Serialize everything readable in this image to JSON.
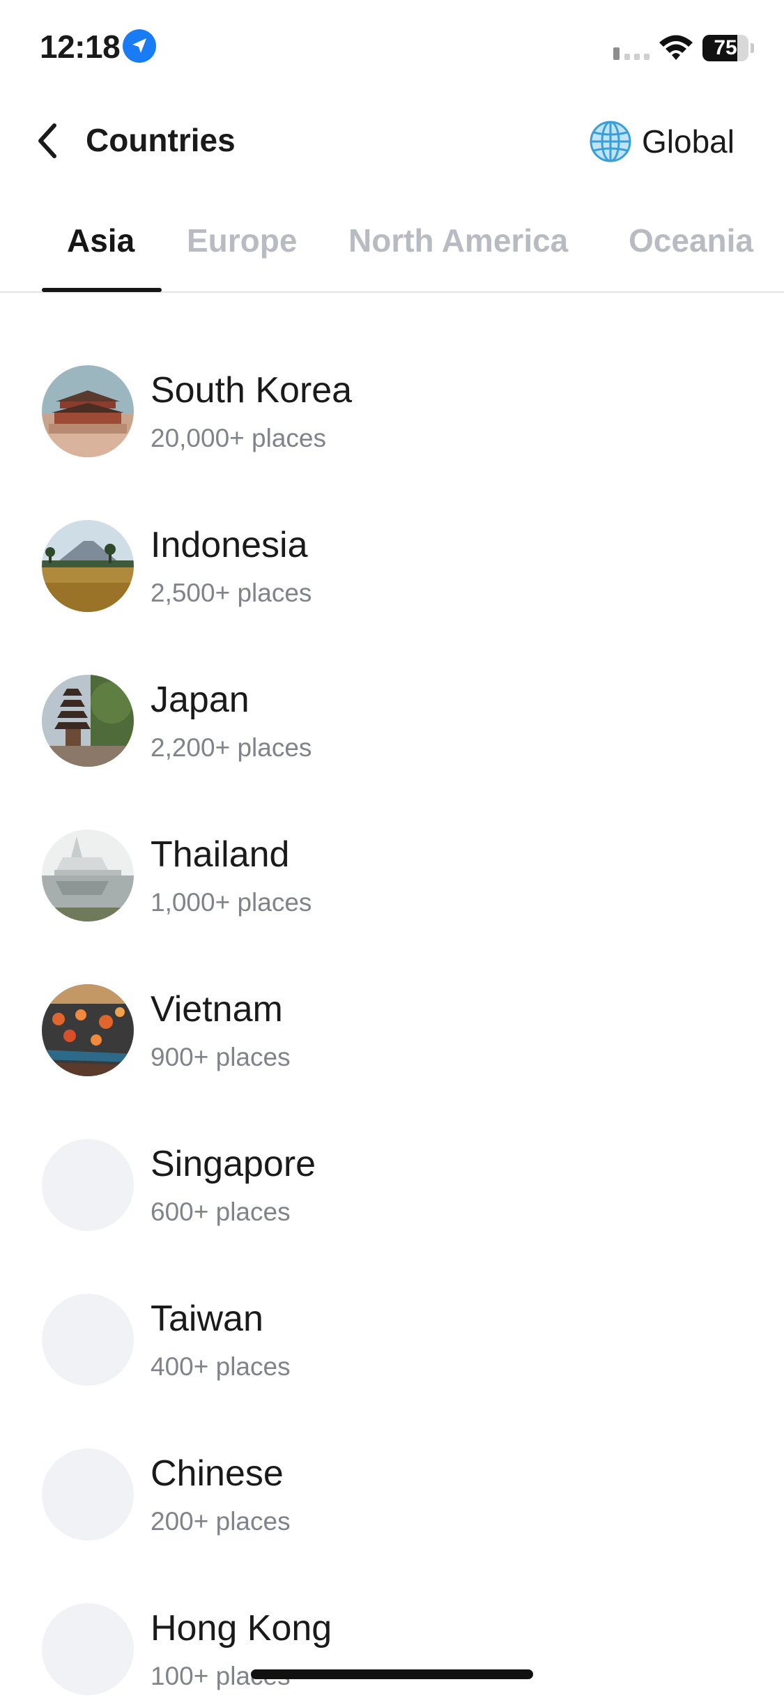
{
  "status_bar": {
    "time": "12:18",
    "battery_level": "75",
    "battery_fraction": 0.75,
    "location_color": "#1a7cf5",
    "icons": [
      "location-arrow-icon",
      "cellular-signal-icon",
      "wifi-icon",
      "battery-icon"
    ]
  },
  "header": {
    "back_icon": "chevron-left-icon",
    "title": "Countries",
    "global_icon": "globe-icon",
    "global_label": "Global",
    "globe_color": "#3a9fd8"
  },
  "tabs": [
    {
      "label": "Asia",
      "active": true
    },
    {
      "label": "Europe",
      "active": false
    },
    {
      "label": "North America",
      "active": false
    },
    {
      "label": "Oceania",
      "active": false
    }
  ],
  "countries": [
    {
      "name": "South Korea",
      "count": "20,000+ places",
      "thumbnail": "palace-photo"
    },
    {
      "name": "Indonesia",
      "count": "2,500+ places",
      "thumbnail": "volcano-field-photo"
    },
    {
      "name": "Japan",
      "count": "2,200+ places",
      "thumbnail": "pagoda-street-photo"
    },
    {
      "name": "Thailand",
      "count": "1,000+ places",
      "thumbnail": "white-temple-photo"
    },
    {
      "name": "Vietnam",
      "count": "900+ places",
      "thumbnail": "lantern-boats-photo"
    },
    {
      "name": "Singapore",
      "count": "600+ places",
      "thumbnail": "placeholder"
    },
    {
      "name": "Taiwan",
      "count": "400+ places",
      "thumbnail": "placeholder"
    },
    {
      "name": "Chinese",
      "count": "200+ places",
      "thumbnail": "placeholder"
    },
    {
      "name": "Hong Kong",
      "count": "100+ places",
      "thumbnail": "placeholder"
    }
  ],
  "colors": {
    "tab_active": "#161616",
    "tab_inactive": "#b9bbc2",
    "secondary_text": "#80838a",
    "placeholder_bg": "#f1f2f5"
  }
}
